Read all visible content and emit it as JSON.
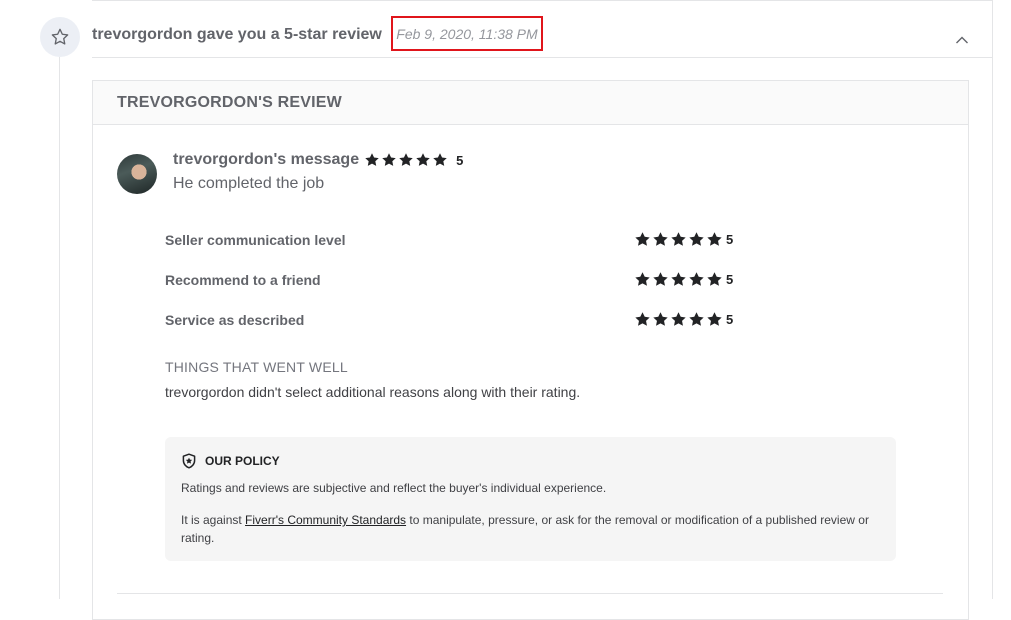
{
  "event": {
    "title": "trevorgordon gave you a 5-star review",
    "timestamp": "Feb 9, 2020, 11:38 PM",
    "icon": "star-outline-icon",
    "collapse_icon": "chevron-up-icon"
  },
  "review": {
    "header": "TREVORGORDON'S REVIEW",
    "reviewer_message_label": "trevorgordon's message",
    "overall_rating": "5",
    "overall_stars": 5,
    "message": "He completed the job",
    "ratings": [
      {
        "label": "Seller communication level",
        "value": "5",
        "stars": 5
      },
      {
        "label": "Recommend to a friend",
        "value": "5",
        "stars": 5
      },
      {
        "label": "Service as described",
        "value": "5",
        "stars": 5
      }
    ],
    "went_well_title": "THINGS THAT WENT WELL",
    "went_well_text": "trevorgordon didn't select additional reasons along with their rating."
  },
  "policy": {
    "title": "OUR POLICY",
    "line1": "Ratings and reviews are subjective and reflect the buyer's individual experience.",
    "line2_prefix": "It is against ",
    "link_text": "Fiverr's Community Standards",
    "line2_suffix": " to manipulate, pressure, or ask for the removal or modification of a published review or rating."
  },
  "colors": {
    "star_fill": "#222325",
    "highlight_border": "#e0151b",
    "badge_bg": "#eceff5"
  }
}
